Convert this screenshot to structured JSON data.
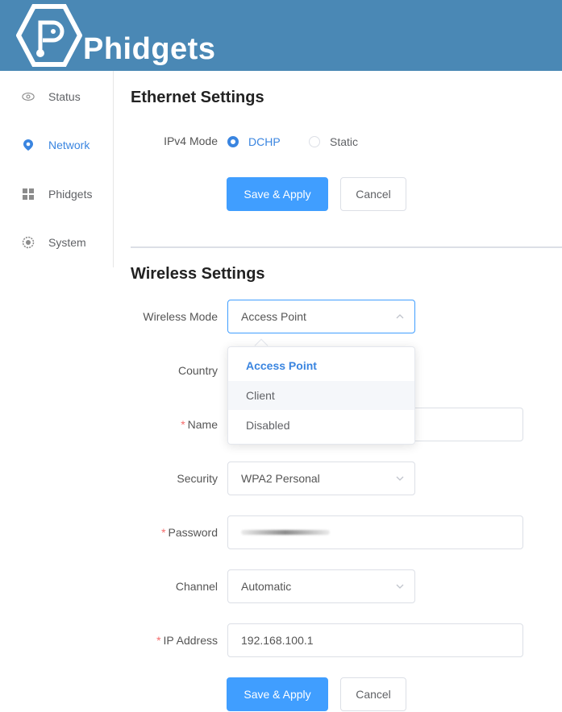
{
  "header": {
    "brand": "Phidgets",
    "bg_color": "#4a88b5"
  },
  "sidebar": {
    "items": [
      {
        "label": "Status",
        "icon": "eye-icon",
        "active": false
      },
      {
        "label": "Network",
        "icon": "location-pin-icon",
        "active": true
      },
      {
        "label": "Phidgets",
        "icon": "grid-icon",
        "active": false
      },
      {
        "label": "System",
        "icon": "gear-icon",
        "active": false
      }
    ]
  },
  "ethernet": {
    "title": "Ethernet Settings",
    "ipv4_label": "IPv4 Mode",
    "options": [
      {
        "label": "DCHP",
        "checked": true
      },
      {
        "label": "Static",
        "checked": false
      }
    ],
    "save_label": "Save & Apply",
    "cancel_label": "Cancel"
  },
  "wireless": {
    "title": "Wireless Settings",
    "mode": {
      "label": "Wireless Mode",
      "value": "Access Point"
    },
    "mode_options": [
      "Access Point",
      "Client",
      "Disabled"
    ],
    "mode_selected": "Access Point",
    "mode_hovered": "Client",
    "country": {
      "label": "Country"
    },
    "name": {
      "label": "Name",
      "required": "*"
    },
    "security": {
      "label": "Security",
      "value": "WPA2 Personal"
    },
    "password": {
      "label": "Password",
      "required": "*"
    },
    "channel": {
      "label": "Channel",
      "value": "Automatic"
    },
    "ip": {
      "label": "IP Address",
      "required": "*",
      "value": "192.168.100.1"
    },
    "save_label": "Save & Apply",
    "cancel_label": "Cancel"
  },
  "colors": {
    "accent": "#409eff",
    "active_text": "#3a85e0",
    "required": "#f56c6c"
  }
}
